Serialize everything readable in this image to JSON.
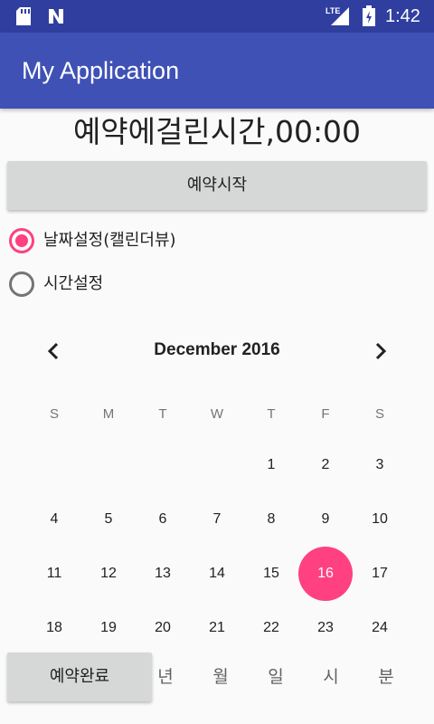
{
  "status_bar": {
    "time": "1:42"
  },
  "app_bar": {
    "title": "My Application"
  },
  "timer_text": "예약에걸린시간,00:00",
  "buttons": {
    "start": "예약시작",
    "done": "예약완료"
  },
  "radios": [
    {
      "label": "날짜설정(캘린더뷰)",
      "checked": true
    },
    {
      "label": "시간설정",
      "checked": false
    }
  ],
  "calendar": {
    "month_label": "December 2016",
    "weekdays": [
      "S",
      "M",
      "T",
      "W",
      "T",
      "F",
      "S"
    ],
    "weeks": [
      [
        "",
        "",
        "",
        "",
        "1",
        "2",
        "3"
      ],
      [
        "4",
        "5",
        "6",
        "7",
        "8",
        "9",
        "10"
      ],
      [
        "11",
        "12",
        "13",
        "14",
        "15",
        "16",
        "17"
      ],
      [
        "18",
        "19",
        "20",
        "21",
        "22",
        "23",
        "24"
      ]
    ],
    "selected_day": "16",
    "accent_color": "#ff4081"
  },
  "bottom_labels": [
    "년",
    "월",
    "일",
    "시",
    "분"
  ],
  "colors": {
    "primary": "#3f51b5",
    "primary_dark": "#303f9f",
    "accent": "#ff4081"
  }
}
